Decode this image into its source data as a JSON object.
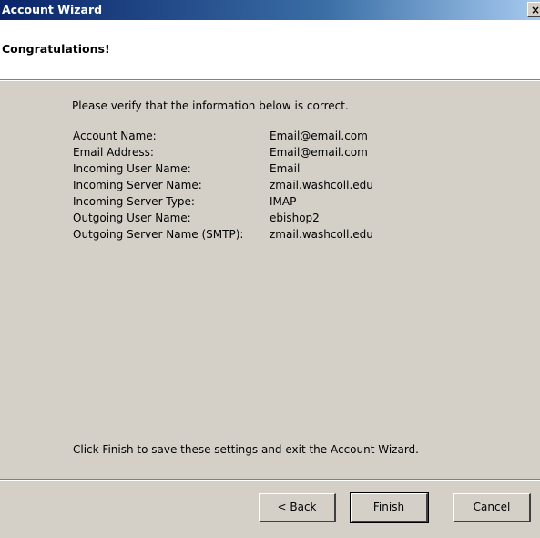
{
  "window": {
    "title": "Account Wizard",
    "close_label": "×"
  },
  "header": {
    "heading": "Congratulations!"
  },
  "content": {
    "intro": "Please verify that the information below is correct.",
    "rows": [
      {
        "label": "Account Name:",
        "value": "Email@email.com"
      },
      {
        "label": "Email Address:",
        "value": "Email@email.com"
      },
      {
        "label": "Incoming User Name:",
        "value": "Email"
      },
      {
        "label": "Incoming Server Name:",
        "value": "zmail.washcoll.edu"
      },
      {
        "label": "Incoming Server Type:",
        "value": "IMAP"
      },
      {
        "label": "Outgoing User Name:",
        "value": "ebishop2"
      },
      {
        "label": "Outgoing Server Name (SMTP):",
        "value": "zmail.washcoll.edu"
      }
    ],
    "outro": "Click Finish to save these settings and exit the Account Wizard."
  },
  "buttons": {
    "back_prefix": "< ",
    "back_accel": "B",
    "back_rest": "ack",
    "finish": "Finish",
    "cancel": "Cancel"
  }
}
